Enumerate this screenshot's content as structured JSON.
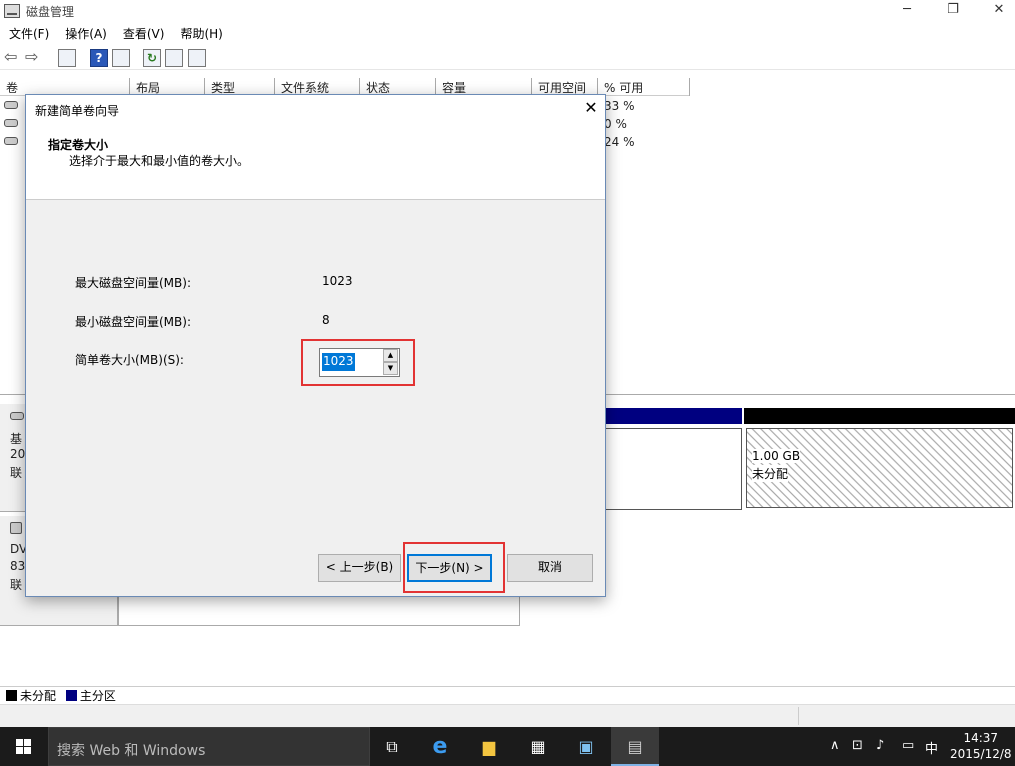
{
  "window": {
    "title": "磁盘管理",
    "min": "─",
    "restore": "❐",
    "close": "✕"
  },
  "menu": [
    "文件(F)",
    "操作(A)",
    "查看(V)",
    "帮助(H)"
  ],
  "toolbar": {
    "back": "⇦",
    "forward": "⇨",
    "help": "?",
    "refresh": "↻"
  },
  "list": {
    "columns": [
      "卷",
      "布局",
      "类型",
      "文件系统",
      "状态",
      "容量",
      "可用空间",
      "% 可用"
    ],
    "rows": [
      {
        "pct": "33 %"
      },
      {
        "pct": "0 %"
      },
      {
        "pct": "24 %"
      }
    ]
  },
  "disks": [
    {
      "line1": "基",
      "line2": "20",
      "line3": "联"
    },
    {
      "line1": "DV",
      "line2": "83",
      "line3": "联"
    }
  ],
  "unallocated": {
    "size": "1.00 GB",
    "label": "未分配"
  },
  "legend": [
    {
      "label": "未分配",
      "color": "#000000"
    },
    {
      "label": "主分区",
      "color": "#000080"
    }
  ],
  "dialog": {
    "title": "新建简单卷向导",
    "close": "✕",
    "step_title": "指定卷大小",
    "step_desc": "选择介于最大和最小值的卷大小。",
    "max_label": "最大磁盘空间量(MB):",
    "max_value": "1023",
    "min_label": "最小磁盘空间量(MB):",
    "min_value": "8",
    "size_label": "简单卷大小(MB)(S):",
    "size_value": "1023",
    "back_btn": "< 上一步(B)",
    "next_btn": "下一步(N) >",
    "cancel_btn": "取消"
  },
  "taskbar": {
    "search_placeholder": "搜索 Web 和 Windows",
    "tray_ime": "中",
    "time": "14:37",
    "date": "2015/12/8"
  }
}
